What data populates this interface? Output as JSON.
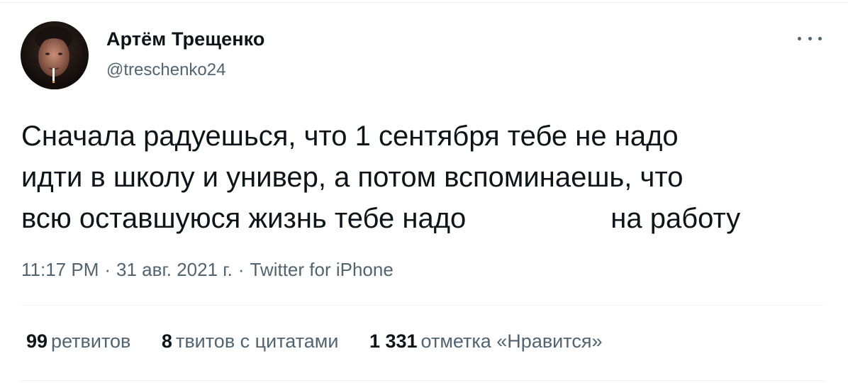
{
  "author": {
    "name": "Артём Трещенко",
    "handle": "@treschenko24",
    "avatar_icon": "profile-photo"
  },
  "menu_icon": "more-options-icon",
  "tweet": {
    "line1": "Сначала радуешься, что 1 сентября тебе не надо",
    "line2": "идти в школу и универ, а потом вспоминаешь, что",
    "line3_before": "всю оставшуюся жизнь тебе надо",
    "line3_after": "на работу"
  },
  "meta": {
    "time": "11:17 PM",
    "date": "31 авг. 2021 г.",
    "source": "Twitter for iPhone",
    "separator": "·"
  },
  "stats": [
    {
      "count": "99",
      "label": "ретвитов"
    },
    {
      "count": "8",
      "label": "твитов с цитатами"
    },
    {
      "count": "1 331",
      "label": "отметка «Нравится»"
    }
  ],
  "colors": {
    "text": "#0f1419",
    "secondary": "#536471",
    "divider": "#eff3f4"
  }
}
